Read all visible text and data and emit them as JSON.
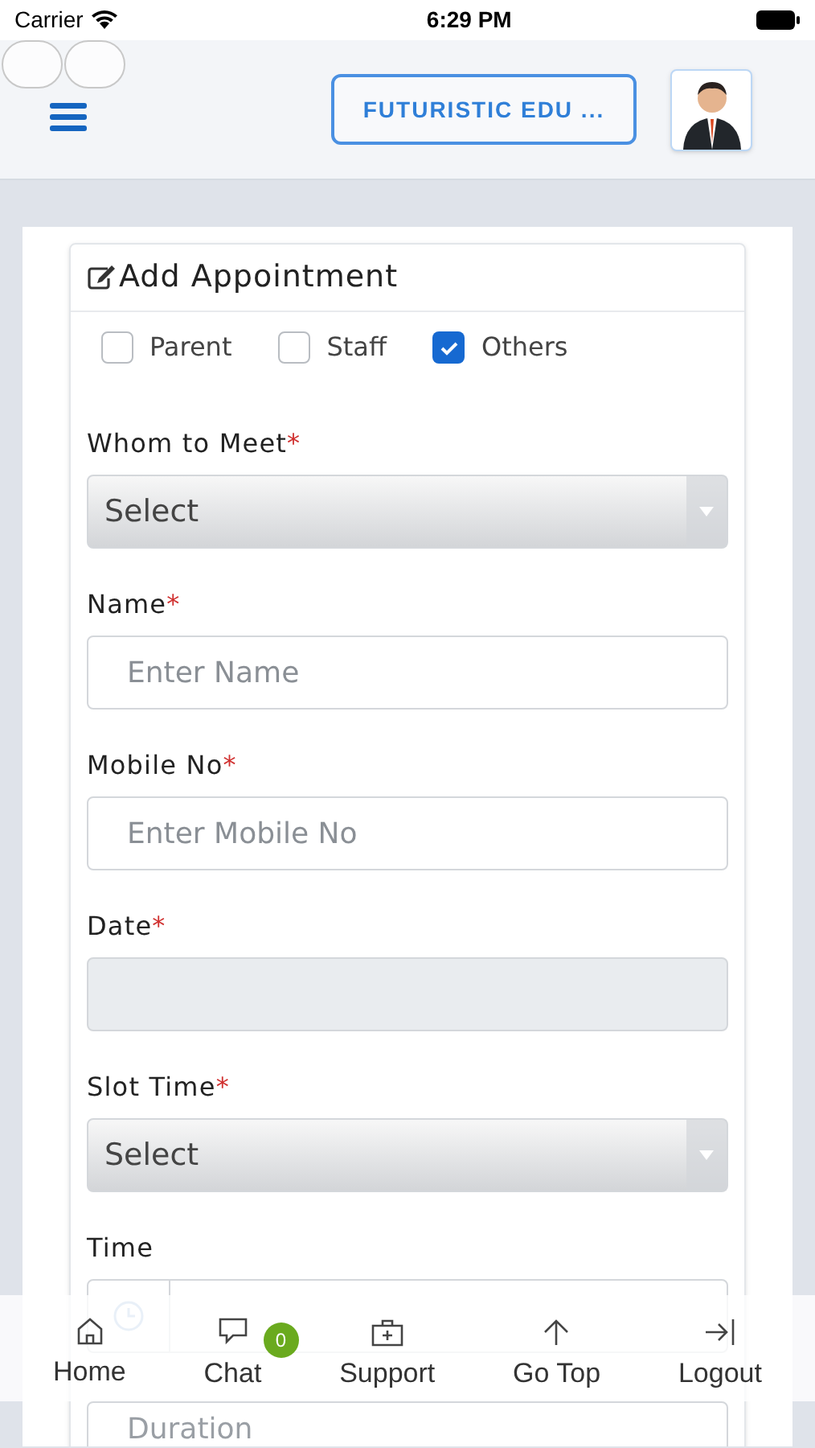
{
  "status_bar": {
    "carrier": "Carrier",
    "time": "6:29 PM"
  },
  "header": {
    "school_button": "FUTURISTIC EDU ..."
  },
  "form": {
    "title": "Add Appointment",
    "types": [
      {
        "label": "Parent",
        "checked": false
      },
      {
        "label": "Staff",
        "checked": false
      },
      {
        "label": "Others",
        "checked": true
      }
    ],
    "fields": [
      {
        "kind": "select",
        "label": "Whom to Meet",
        "required_mark": "*",
        "value": "Select"
      },
      {
        "kind": "input",
        "label": "Name",
        "required_mark": "*",
        "placeholder": "Enter Name"
      },
      {
        "kind": "input",
        "label": "Mobile No",
        "required_mark": "*",
        "placeholder": "Enter Mobile No"
      },
      {
        "kind": "disabled",
        "label": "Date",
        "required_mark": "*"
      },
      {
        "kind": "select",
        "label": "Slot Time",
        "required_mark": "*",
        "value": "Select"
      },
      {
        "kind": "time",
        "label": "Time"
      },
      {
        "kind": "input",
        "placeholder": "Duration"
      }
    ]
  },
  "bottom_nav": [
    {
      "label": "Home"
    },
    {
      "label": "Chat",
      "badge": "0"
    },
    {
      "label": "Support"
    },
    {
      "label": "Go Top"
    },
    {
      "label": "Logout"
    }
  ]
}
